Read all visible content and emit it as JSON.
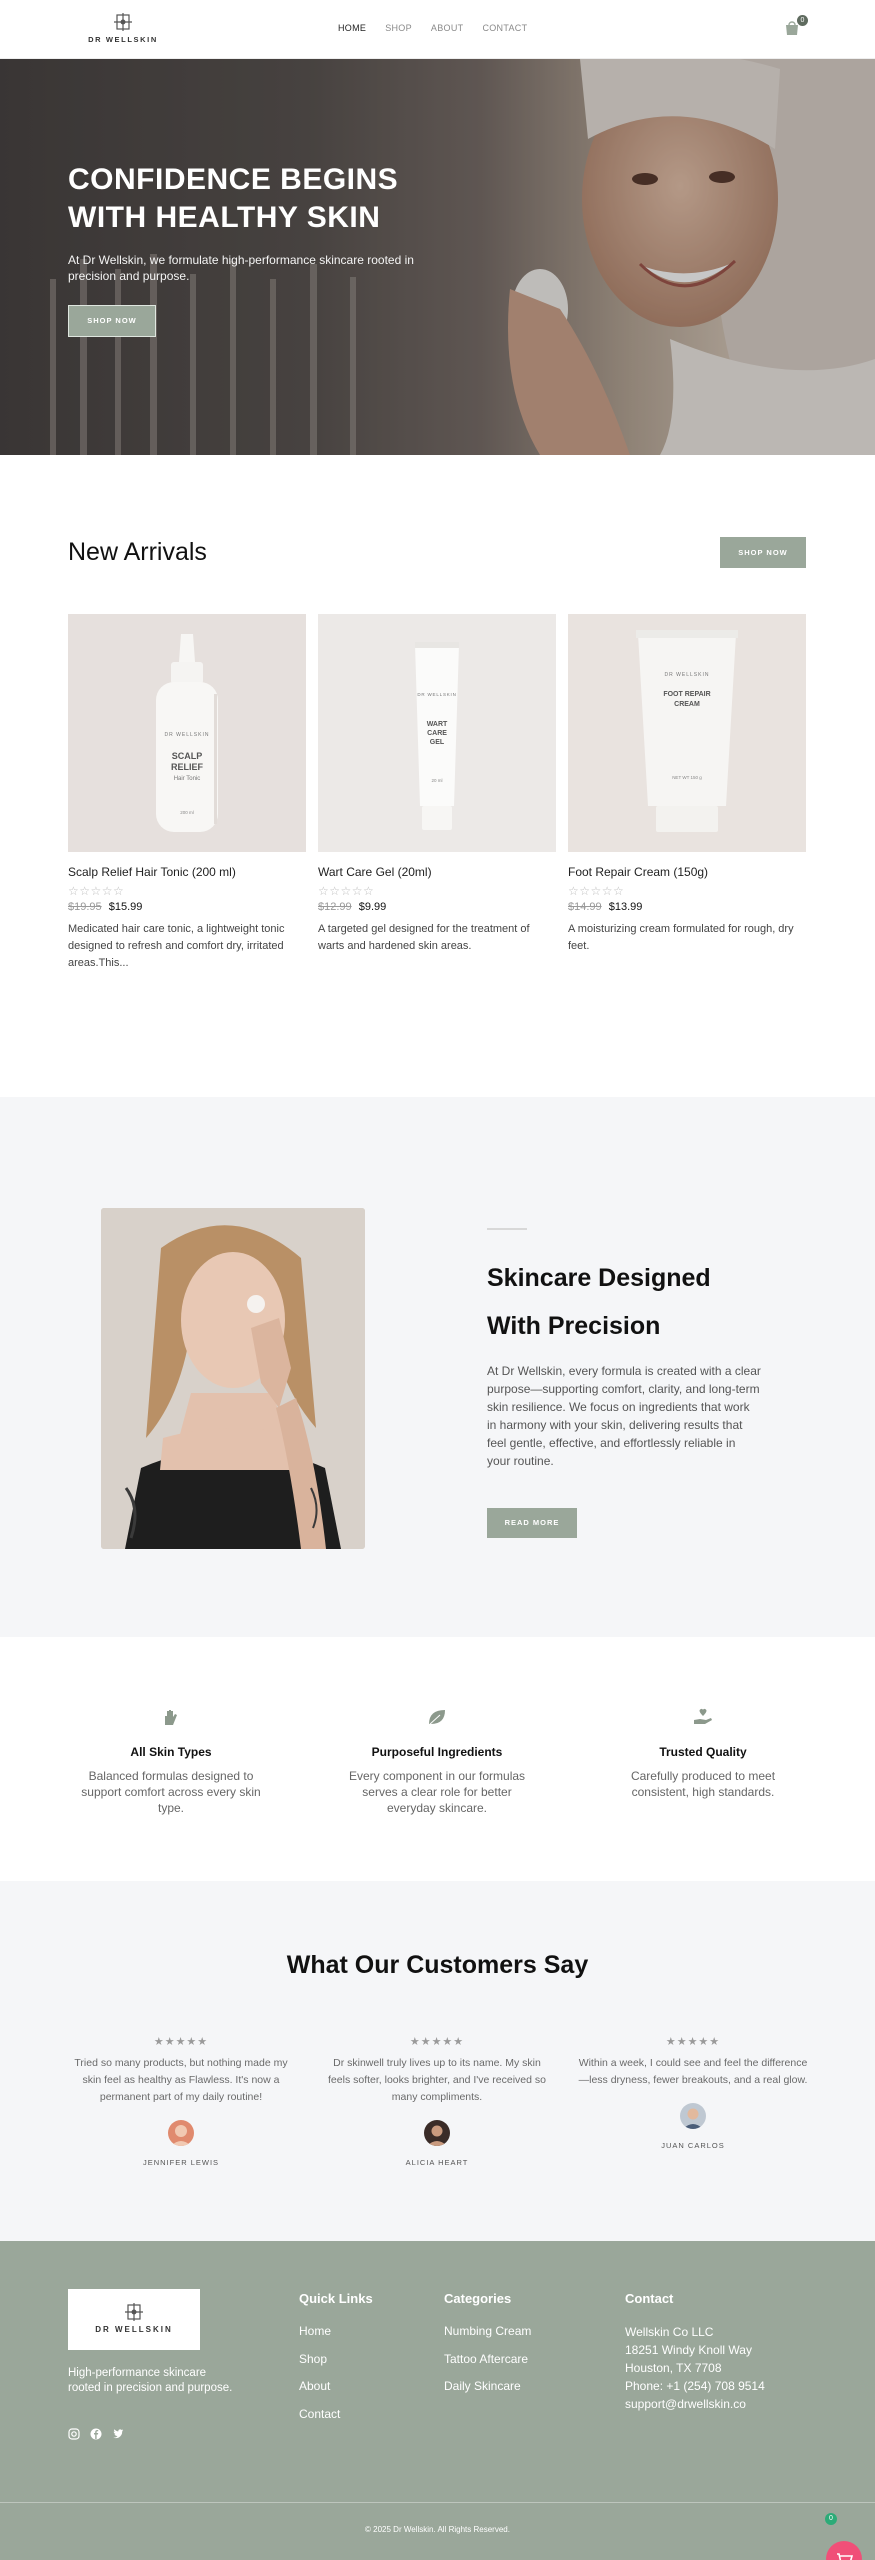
{
  "header": {
    "logo_text": "DR WELLSKIN",
    "nav": [
      "HOME",
      "SHOP",
      "ABOUT",
      "CONTACT"
    ],
    "cart_count": "0"
  },
  "hero": {
    "title_line1": "CONFIDENCE BEGINS",
    "title_line2": "WITH HEALTHY SKIN",
    "subtitle": "At Dr Wellskin, we formulate high-performance skincare rooted in precision and purpose.",
    "button": "SHOP NOW"
  },
  "new_arrivals": {
    "title": "New Arrivals",
    "button": "SHOP NOW",
    "products": [
      {
        "name": "Scalp Relief Hair Tonic (200 ml)",
        "old_price": "$19.95",
        "price": "$15.99",
        "description": "Medicated hair care tonic, a lightweight tonic designed to refresh and comfort dry, irritated areas.This...",
        "label_lines": [
          "SCALP",
          "RELIEF",
          "Hair Tonic"
        ],
        "label_volume": "200 ml"
      },
      {
        "name": "Wart Care Gel (20ml)",
        "old_price": "$12.99",
        "price": "$9.99",
        "description": "A targeted gel designed for the treatment of warts and hardened skin areas.",
        "label_lines": [
          "WART",
          "CARE",
          "GEL"
        ],
        "label_volume": "20 ml"
      },
      {
        "name": "Foot Repair Cream (150g)",
        "old_price": "$14.99",
        "price": "$13.99",
        "description": "A moisturizing cream formulated for rough, dry feet.",
        "label_lines": [
          "FOOT REPAIR",
          "CREAM"
        ],
        "label_volume": "NET WT 150 g"
      }
    ],
    "stars": "☆☆☆☆☆"
  },
  "about": {
    "title_line1": "Skincare Designed",
    "title_line2": "With Precision",
    "text": "At Dr Wellskin, every formula is created with a clear purpose—supporting comfort, clarity, and long-term skin resilience. We focus on ingredients that work in harmony with your skin, delivering results that feel gentle, effective, and effortlessly reliable in your routine.",
    "button": "READ MORE"
  },
  "features": [
    {
      "icon": "hand-icon",
      "title": "All Skin Types",
      "text": "Balanced formulas designed to support comfort across every skin type."
    },
    {
      "icon": "leaf-icon",
      "title": "Purposeful Ingredients",
      "text": "Every component in our formulas serves a clear role for better everyday skincare."
    },
    {
      "icon": "hand-heart-icon",
      "title": "Trusted Quality",
      "text": "Carefully produced to meet consistent, high standards."
    }
  ],
  "testimonials": {
    "title": "What Our Customers Say",
    "stars": "★★★★★",
    "items": [
      {
        "text": "Tried so many products, but nothing made my skin feel as healthy as Flawless. It's now a permanent part of my daily routine!",
        "name": "JENNIFER LEWIS"
      },
      {
        "text": "Dr skinwell truly lives up to its name. My skin feels softer, looks brighter, and I've received so many compliments.",
        "name": "ALICIA HEART"
      },
      {
        "text": "Within a week, I could see and feel the difference—less dryness, fewer breakouts, and a real glow.",
        "name": "JUAN CARLOS"
      }
    ]
  },
  "footer": {
    "logo_text": "DR WELLSKIN",
    "tagline": "High-performance skincare rooted in precision and purpose.",
    "quick_links": {
      "title": "Quick Links",
      "items": [
        "Home",
        "Shop",
        "About",
        "Contact"
      ]
    },
    "categories": {
      "title": "Categories",
      "items": [
        "Numbing Cream",
        "Tattoo Aftercare",
        "Daily Skincare"
      ]
    },
    "contact": {
      "title": "Contact",
      "lines": [
        "Wellskin Co LLC",
        "18251 Windy Knoll Way",
        "Houston, TX 7708",
        "Phone: +1 (254) 708 9514",
        "support@drwellskin.co"
      ]
    },
    "copyright": "© 2025 Dr Wellskin. All Rights Reserved."
  },
  "floating_cart": {
    "count": "0"
  },
  "colors": {
    "accent": "#9aa79a",
    "section_bg": "#f5f6f8",
    "fab": "#f04f78"
  }
}
